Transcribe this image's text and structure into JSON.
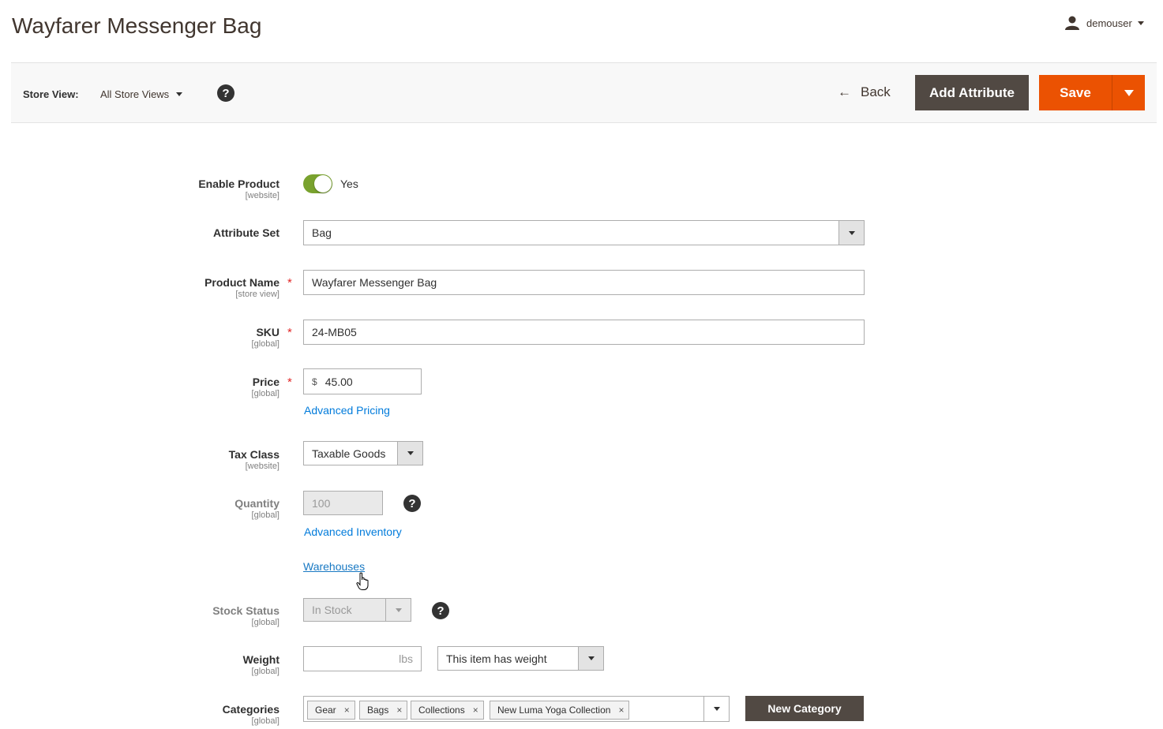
{
  "header": {
    "title": "Wayfarer Messenger Bag",
    "user": "demouser"
  },
  "toolbar": {
    "store_view_label": "Store View:",
    "store_view_value": "All Store Views",
    "help": "?",
    "back_label": "Back",
    "back_arrow": "←",
    "add_attribute_label": "Add Attribute",
    "save_label": "Save"
  },
  "form": {
    "enable_product": {
      "label": "Enable Product",
      "scope": "[website]",
      "value": "Yes",
      "checked": true
    },
    "attribute_set": {
      "label": "Attribute Set",
      "value": "Bag"
    },
    "product_name": {
      "label": "Product Name",
      "scope": "[store view]",
      "value": "Wayfarer Messenger Bag",
      "required": "*"
    },
    "sku": {
      "label": "SKU",
      "scope": "[global]",
      "value": "24-MB05",
      "required": "*"
    },
    "price": {
      "label": "Price",
      "scope": "[global]",
      "currency": "$",
      "value": "45.00",
      "required": "*",
      "advanced_link": "Advanced Pricing"
    },
    "tax_class": {
      "label": "Tax Class",
      "scope": "[website]",
      "value": "Taxable Goods"
    },
    "quantity": {
      "label": "Quantity",
      "scope": "[global]",
      "value": "100",
      "advanced_link": "Advanced Inventory",
      "warehouses_link": "Warehouses"
    },
    "stock_status": {
      "label": "Stock Status",
      "scope": "[global]",
      "value": "In Stock"
    },
    "weight": {
      "label": "Weight",
      "scope": "[global]",
      "value": "",
      "unit": "lbs",
      "type_value": "This item has weight"
    },
    "categories": {
      "label": "Categories",
      "scope": "[global]",
      "tags": [
        "Gear",
        "Bags",
        "Collections",
        "New Luma Yoga Collection"
      ],
      "remove_glyph": "×",
      "new_category_label": "New Category"
    }
  },
  "colors": {
    "accent": "#eb5202",
    "dark_button": "#514943",
    "toggle_on": "#79a22e",
    "link": "#007bdb",
    "required": "#e22626"
  }
}
